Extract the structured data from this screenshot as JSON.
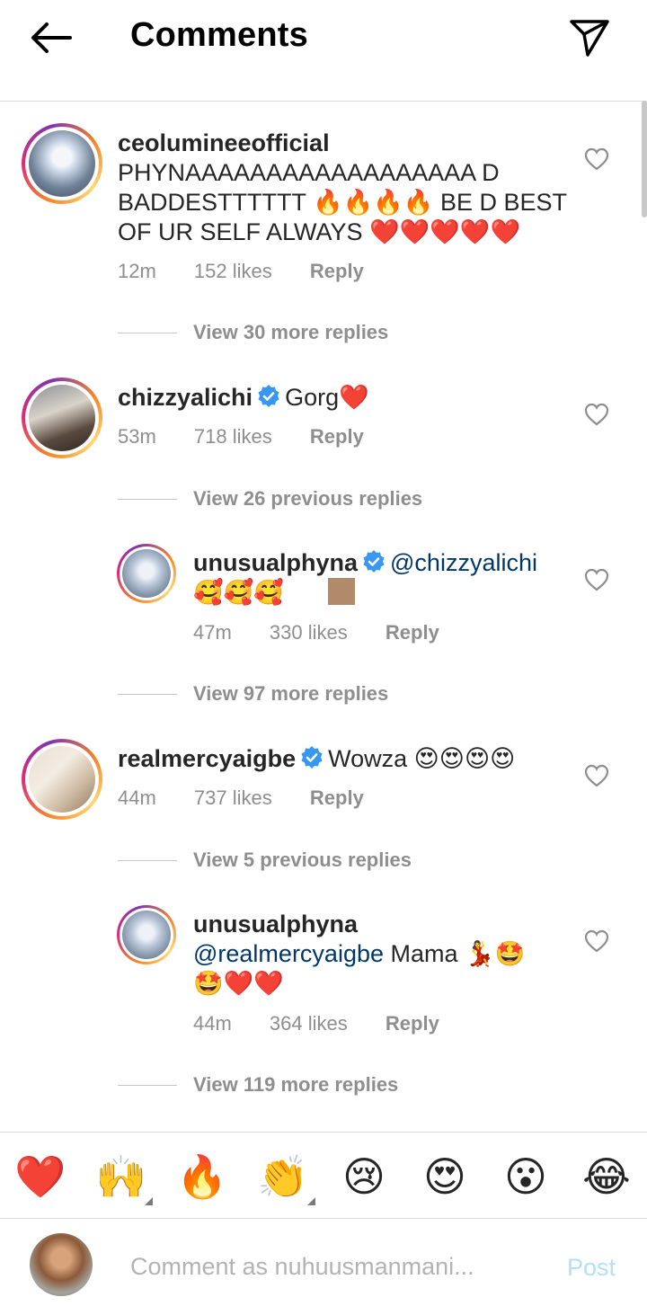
{
  "header": {
    "title": "Comments"
  },
  "comments": [
    {
      "username": "ceolumineeofficial",
      "lines": [
        "PHYNAAAAAAAAAAAAAAAAAA D",
        "BADDESTTTTTT 🔥🔥🔥🔥 BE D BEST",
        "OF UR SELF ALWAYS ❤️❤️❤️❤️❤️"
      ],
      "time": "12m",
      "likes": "152 likes",
      "reply": "Reply",
      "view_more": "View 30 more replies"
    },
    {
      "username": "chizzyalichi",
      "text": "Gorg❤️",
      "time": "53m",
      "likes": "718 likes",
      "reply": "Reply",
      "view_more": "View 26 previous replies"
    },
    {
      "username": "unusualphyna",
      "mention": "@chizzyalichi",
      "text2": "🥰🥰🥰",
      "time": "47m",
      "likes": "330 likes",
      "reply": "Reply",
      "view_more": "View 97 more replies"
    },
    {
      "username": "realmercyaigbe",
      "text": "Wowza 😍😍😍😍",
      "time": "44m",
      "likes": "737 likes",
      "reply": "Reply",
      "view_more": "View 5 previous replies"
    },
    {
      "username": "unusualphyna",
      "mention": "@realmercyaigbe",
      "text": "Mama 💃🤩",
      "text2": "🤩❤️❤️",
      "time": "44m",
      "likes": "364 likes",
      "reply": "Reply",
      "view_more": "View 119 more replies"
    }
  ],
  "emoji_bar": [
    "❤️",
    "🙌",
    "🔥",
    "👏",
    "😢",
    "😍",
    "😮",
    "😂"
  ],
  "composer": {
    "placeholder": "Comment as nuhuusmanmani...",
    "post_label": "Post"
  },
  "colors": {
    "mention": "#00376b",
    "verified": "#3897f0",
    "post_disabled": "#b2dffc"
  }
}
